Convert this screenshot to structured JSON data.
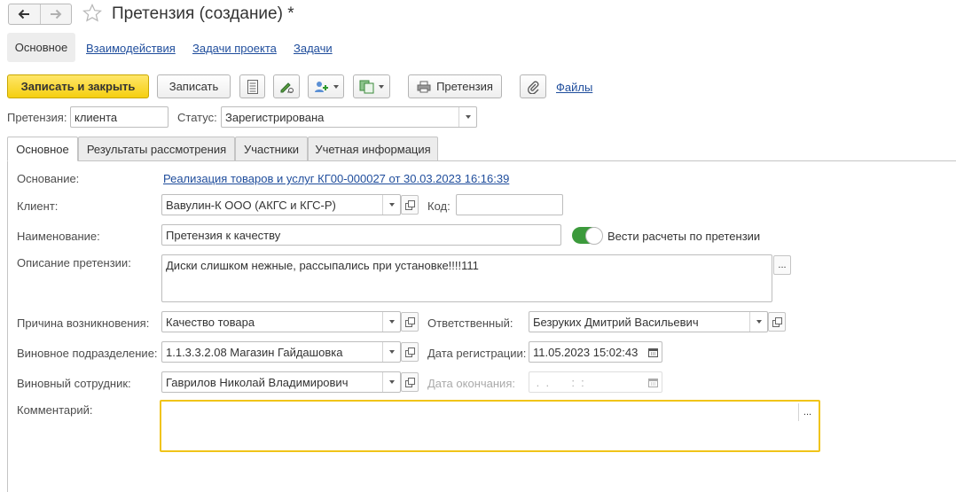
{
  "window": {
    "title": "Претензия (создание) *"
  },
  "top_nav": {
    "active": "Основное",
    "links": [
      "Взаимодействия",
      "Задачи проекта",
      "Задачи"
    ]
  },
  "toolbar": {
    "save_close": "Записать и закрыть",
    "save": "Записать",
    "print_label": "Претензия",
    "files": "Файлы"
  },
  "header_fields": {
    "claim_label": "Претензия:",
    "claim_value": "клиента",
    "status_label": "Статус:",
    "status_value": "Зарегистрирована"
  },
  "tabs": [
    "Основное",
    "Результаты рассмотрения",
    "Участники",
    "Учетная информация"
  ],
  "form": {
    "basis_label": "Основание:",
    "basis_value": "Реализация товаров и услуг КГ00-000027 от 30.03.2023 16:16:39",
    "client_label": "Клиент:",
    "client_value": "Вавулин-К ООО (АКГС и КГС-Р)",
    "code_label": "Код:",
    "code_value": "",
    "name_label": "Наименование:",
    "name_value": "Претензия к качеству",
    "settlement_toggle_label": "Вести расчеты по претензии",
    "settlement_toggle_on": true,
    "description_label": "Описание претензии:",
    "description_value": "Диски слишком нежные, рассыпались при установке!!!!111",
    "reason_label": "Причина возникновения:",
    "reason_value": "Качество товара",
    "responsible_label": "Ответственный:",
    "responsible_value": "Безруких Дмитрий Васильевич",
    "department_label": "Виновное подразделение:",
    "department_value": "1.1.3.3.2.08 Магазин Гайдашовка",
    "reg_date_label": "Дата регистрации:",
    "reg_date_value": "11.05.2023 15:02:43",
    "employee_label": "Виновный сотрудник:",
    "employee_value": "Гаврилов Николай Владимирович",
    "end_date_label": "Дата окончания:",
    "end_date_placeholder": " .  .       :  :",
    "comment_label": "Комментарий:",
    "comment_value": ""
  },
  "colors": {
    "primary_button": "#f5cf10",
    "link": "#1f4d9c",
    "toggle_on": "#3c9a3c",
    "focus_border": "#f0c419"
  }
}
